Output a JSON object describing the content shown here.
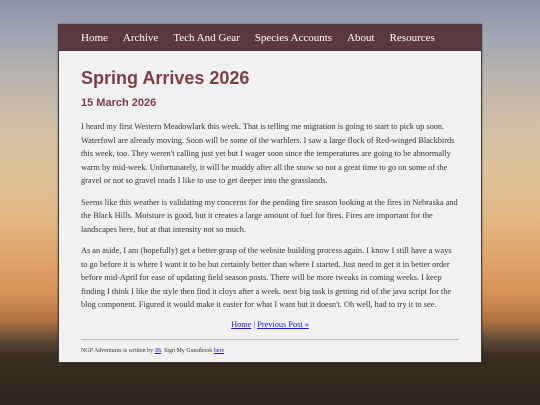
{
  "nav": {
    "items": [
      {
        "label": "Home"
      },
      {
        "label": "Archive"
      },
      {
        "label": "Tech And Gear"
      },
      {
        "label": "Species Accounts"
      },
      {
        "label": "About"
      },
      {
        "label": "Resources"
      }
    ]
  },
  "post": {
    "title": "Spring Arrives 2026",
    "date": "15 March 2026",
    "paragraphs": [
      "I heard my first Western Meadowlark this week. That is telling me migration is going to start to pick up soon. Waterfowl are already moving. Soon will be some of the warblers. I saw a large flock of Red-winged Blackbirds this week, too. They weren't calling just yet but I wager soon since the temperatures are going to be abnormally warm by mid-week. Unfortunately, it will be muddy after all the snow so not a great time to go on some of the gravel or not so gravel roads I like to use to get deeper into the grasslands.",
      "Seems like this weather is validating my concerns for the pending fire season looking at the fires in Nebraska and the Black Hills. Moisture is good, but it creates a large amount of fuel for fires. Fires are important for the landscapes here, but at that intensity not so much.",
      "As an aside, I am (hopefully) get a better grasp of the website building process again. I know I still have a ways to go before it is where I want it to be but certainly better than where I started. Just need to get it in better order before mid-April for ease of updating field season posts. There will be more tweaks in coming weeks. I keep finding I think I like the style then find it cloys after a week. next big task is getting rid of the java script for the blog component. Figured it would make it easier for what I want but it doesn't. Oh well, had to try it to see."
    ]
  },
  "post_nav": {
    "home_label": "Home",
    "separator": " | ",
    "previous_label": "Previous Post »"
  },
  "footer": {
    "text_before": "NGP Adventures is written by ",
    "author_link": "JB",
    "text_middle": ". Sign My Guestbook ",
    "guestbook_link": "here"
  }
}
